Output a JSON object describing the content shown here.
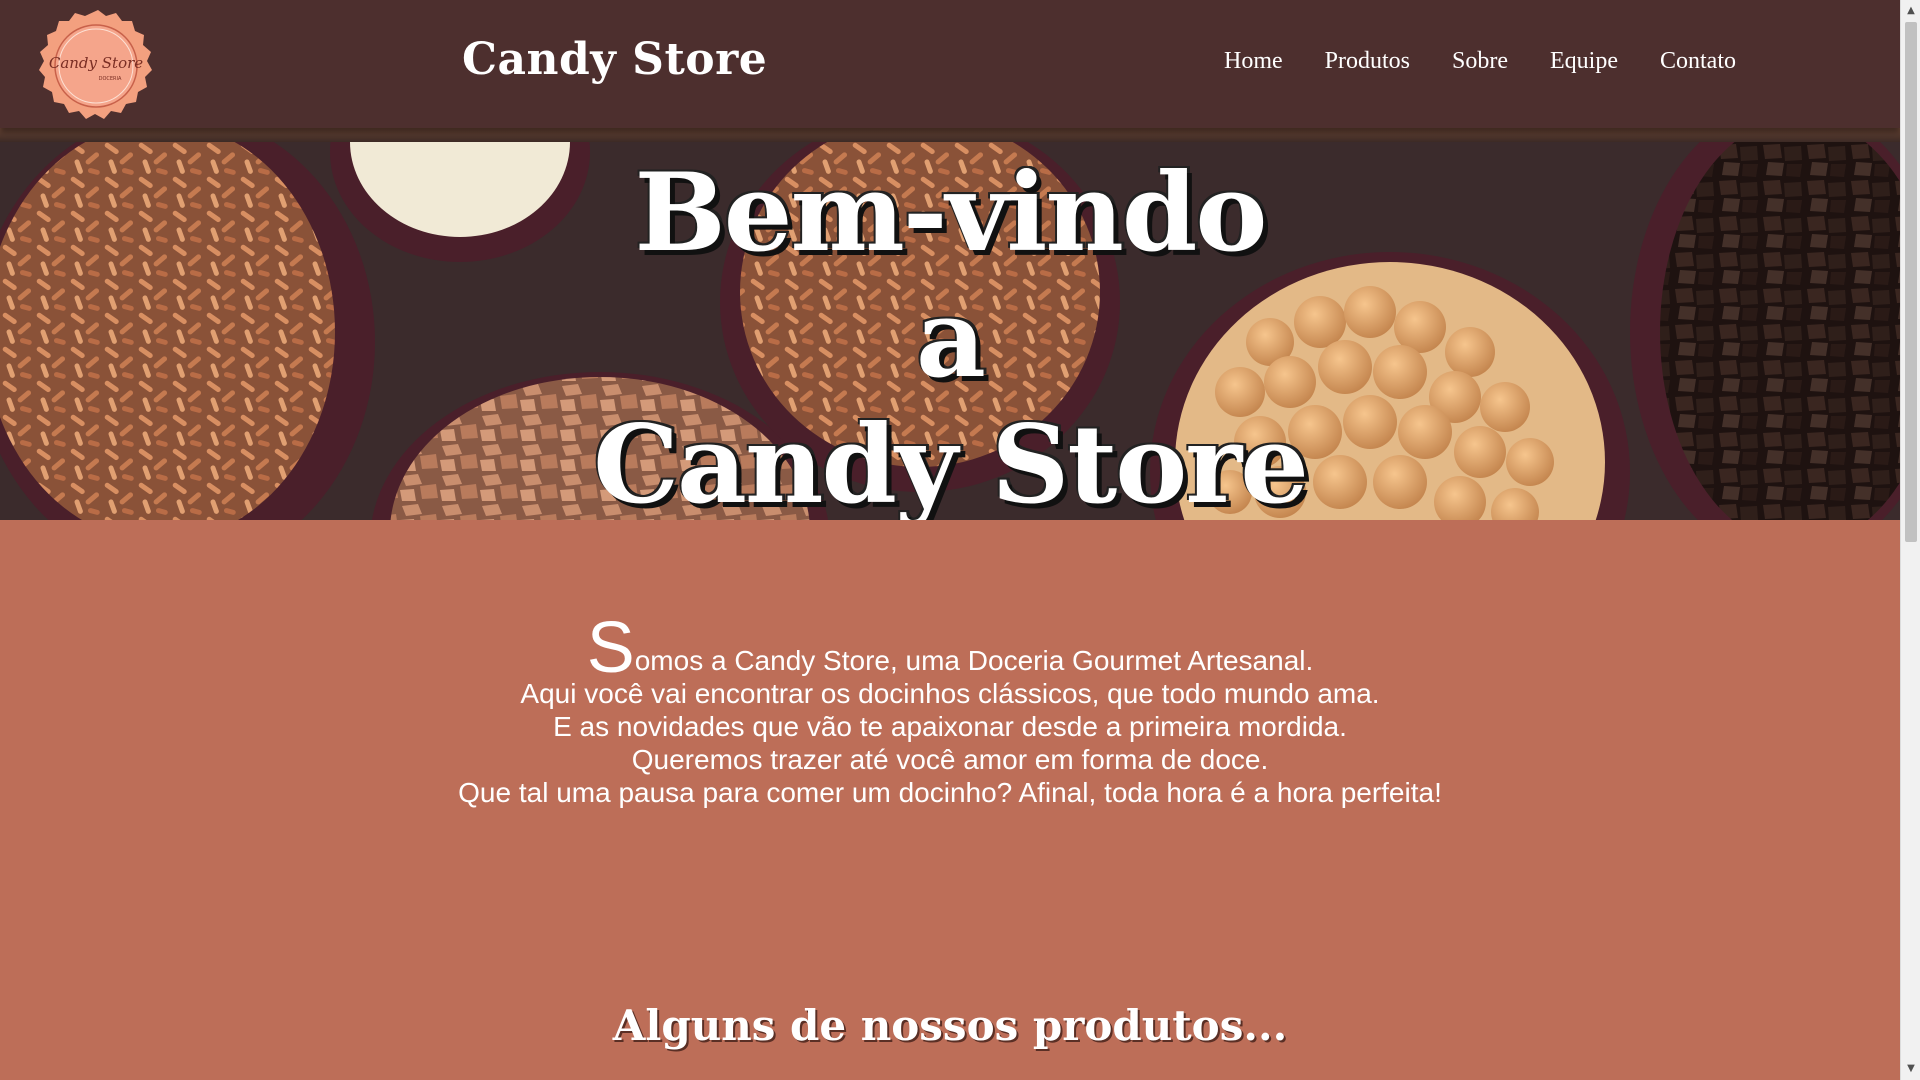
{
  "header": {
    "logo_text": "Candy Store",
    "logo_subtext": "DOCERIA",
    "brand": "Candy Store",
    "nav": [
      {
        "label": "Home"
      },
      {
        "label": "Produtos"
      },
      {
        "label": "Sobre"
      },
      {
        "label": "Equipe"
      },
      {
        "label": "Contato"
      }
    ]
  },
  "hero": {
    "line1": "Bem-vindo",
    "line2": "a",
    "line3": "Candy Store"
  },
  "intro": {
    "dropcap": "S",
    "first_line_rest": "omos a Candy Store, uma Doceria Gourmet Artesanal.",
    "lines": [
      "Aqui você vai encontrar os docinhos clássicos, que todo mundo ama.",
      "E as novidades que vão te apaixonar desde a primeira mordida.",
      "Queremos trazer até você amor em forma de doce.",
      "Que tal uma pausa para comer um docinho? Afinal, toda hora é a hora perfeita!"
    ]
  },
  "products_section": {
    "title": "Alguns de nossos produtos..."
  },
  "colors": {
    "header_bg": "#4d2f2e",
    "page_bg": "#bd6e58",
    "logo_bg": "#f09a7c",
    "text": "#ffffff"
  },
  "icons": {
    "scroll_up": "scroll-up-arrow-icon",
    "scroll_down": "scroll-down-arrow-icon"
  }
}
